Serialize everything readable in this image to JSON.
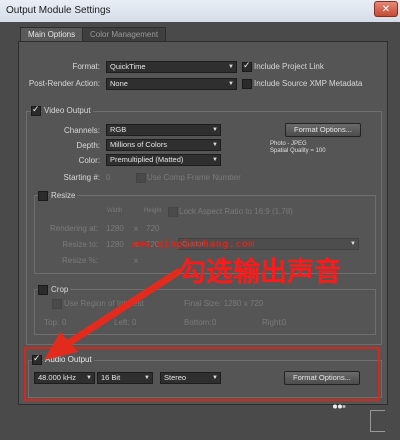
{
  "window": {
    "title": "Output Module Settings",
    "close_glyph": "✕",
    "tabs": [
      "Main Options",
      "Color Management"
    ]
  },
  "main": {
    "format": {
      "label": "Format:",
      "value": "QuickTime"
    },
    "post_render": {
      "label": "Post-Render Action:",
      "value": "None"
    },
    "include_project_link": "Include Project Link",
    "include_xmp": "Include Source XMP Metadata"
  },
  "video": {
    "label": "Video Output",
    "channels": {
      "label": "Channels:",
      "value": "RGB"
    },
    "depth": {
      "label": "Depth:",
      "value": "Millions of Colors"
    },
    "color": {
      "label": "Color:",
      "value": "Premultiplied (Matted)"
    },
    "starting": {
      "label": "Starting #:",
      "value": "0"
    },
    "use_comp_frame": "Use Comp Frame Number",
    "format_options": "Format Options...",
    "codec_line1": "Photo - JPEG",
    "codec_line2": "Spatial Quality = 100"
  },
  "resize": {
    "label": "Resize",
    "width_header": "Width",
    "height_header": "Height",
    "lock_aspect": "Lock Aspect Ratio to 16:9 (1.78)",
    "rendering_at": {
      "label": "Rendering at:",
      "w": "1280",
      "x": "x",
      "h": "720"
    },
    "resize_to": {
      "label": "Resize to:",
      "w": "1280",
      "x": "x",
      "h": "720",
      "preset": "Custom"
    },
    "resize_pct": {
      "label": "Resize %:",
      "x": "x"
    }
  },
  "crop": {
    "label": "Crop",
    "use_roi": "Use Region of Interest",
    "final_size": "Final Size: 1280 x 720",
    "top": {
      "label": "Top:",
      "value": "0"
    },
    "left": {
      "label": "Left:",
      "value": "0"
    },
    "bottom": {
      "label": "Bottom:",
      "value": "0"
    },
    "right": {
      "label": "Right:",
      "value": "0"
    }
  },
  "audio": {
    "label": "Audio Output",
    "rate": "48.000 kHz",
    "bits": "16 Bit",
    "channels": "Stereo",
    "format_options": "Format Options..."
  },
  "overlay": {
    "watermark": "www.qinpinchang.com",
    "annotation": "勾选输出声音",
    "color": "#d9261c"
  },
  "icons": {
    "checkmark": "check-icon",
    "dropdown": "chevron-down-icon",
    "close": "close-icon",
    "arrow": "red-arrow-icon"
  }
}
